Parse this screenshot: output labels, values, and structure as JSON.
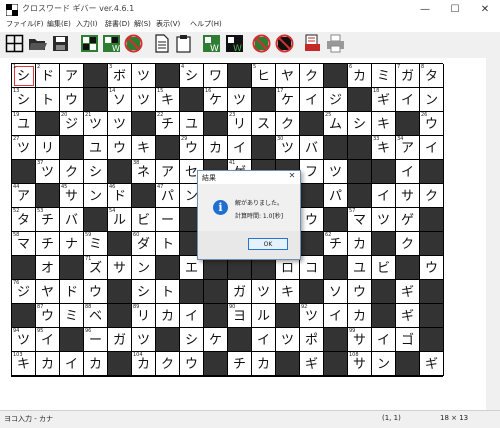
{
  "window": {
    "title": "クロスワード ギバー ver.4.6.1",
    "min_glyph": "—",
    "max_glyph": "☐",
    "close_glyph": "✕"
  },
  "menu": [
    "ファイル(F)",
    "編集(E)",
    "入力(I)",
    "辞書(D)",
    "解(S)",
    "表示(V)",
    "ヘルプ(H)"
  ],
  "toolbar_icons": [
    "new-grid-icon",
    "open-folder-icon",
    "save-icon",
    "pattern-icon",
    "pattern-w-icon",
    "no-pattern-icon",
    "document-icon",
    "clipboard-icon",
    "solve-w-icon",
    "solve-icon",
    "solve-no-icon",
    "solve-no-bold-icon",
    "print-preview-icon",
    "print-icon"
  ],
  "grid": {
    "cols": 18,
    "rows": 13,
    "cells": [
      [
        "1|シ",
        "2|ド",
        "|ア",
        "#",
        "3|ボ",
        "|ツ",
        "#",
        "4|シ",
        "|ワ",
        "#",
        "5|ヒ",
        "|ヤ",
        "|ク",
        "#",
        "6|カ",
        "|ミ",
        "7|ガ",
        "8|タ"
      ],
      [
        "13|シ",
        "|ト",
        "|ウ",
        "#",
        "14|ソ",
        "|ツ",
        "15|キ",
        "#",
        "16|ケ",
        "|ツ",
        "#",
        "17|ケ",
        "|イ",
        "|ジ",
        "#",
        "18|ギ",
        "|イ",
        "|ン"
      ],
      [
        "19|ユ",
        "#",
        "20|ジ",
        "21|ツ",
        "|ツ",
        "#",
        "22|チ",
        "|ユ",
        "#",
        "23|リ",
        "|ス",
        "|ク",
        "#",
        "25|ム",
        "|シ",
        "|キ",
        "#",
        "26|ウ"
      ],
      [
        "27|ツ",
        "|リ",
        "#",
        "|ユ",
        "|ウ",
        "|キ",
        "#",
        "29|ウ",
        "|カ",
        "|イ",
        "#",
        "30|ツ",
        "|バ",
        "#",
        "#",
        "33|キ",
        "34|ア",
        "|イ"
      ],
      [
        "#",
        "37|ツ",
        "|ク",
        "|シ",
        "#",
        "38|ネ",
        "|ア",
        "|セ",
        "#",
        "41|ゲ",
        "#",
        "#",
        "|フ",
        "|ツ",
        "#",
        "#",
        "|イ",
        "#"
      ],
      [
        "44|ア",
        "#",
        "45|サ",
        "|ン",
        "46|ド",
        "#",
        "47|パ",
        "|ン",
        "#",
        "#",
        "#",
        "#",
        "#",
        "|パ",
        "#",
        "|イ",
        "|サ",
        "|ク"
      ],
      [
        "52|タ",
        "53|チ",
        "|バ",
        "#",
        "54|ル",
        "|ビ",
        "|ー",
        "#",
        "#",
        "#",
        "#",
        "#",
        "|ウ",
        "#",
        "57|マ",
        "|ツ",
        "|ゲ",
        "#"
      ],
      [
        "58|マ",
        "|チ",
        "|ナ",
        "59|ミ",
        "#",
        "60|ダ",
        "|ト",
        "#",
        "#",
        "#",
        "#",
        "#",
        "#",
        "62|チ",
        "|カ",
        "#",
        "|ク",
        "#"
      ],
      [
        "#",
        "|オ",
        "#",
        "71|ズ",
        "|サ",
        "|ン",
        "#",
        "|エ",
        "#",
        "#",
        "#",
        "|ロ",
        "|コ",
        "#",
        "|ユ",
        "|ビ",
        "#",
        "|ウ"
      ],
      [
        "76|ジ",
        "|ヤ",
        "|ド",
        "|ウ",
        "#",
        "|シ",
        "|ト",
        "#",
        "#",
        "|ガ",
        "|ツ",
        "|キ",
        "#",
        "|ソ",
        "|ウ",
        "#",
        "|ギ",
        "#"
      ],
      [
        "#",
        "87|ウ",
        "|ミ",
        "88|ベ",
        "#",
        "89|リ",
        "|カ",
        "|イ",
        "#",
        "90|ヨ",
        "|ル",
        "#",
        "92|ツ",
        "|イ",
        "|カ",
        "#",
        "|ギ",
        "#"
      ],
      [
        "94|ツ",
        "95|イ",
        "#",
        "96|ー",
        "|ガ",
        "|ツ",
        "#",
        "|シ",
        "|ケ",
        "#",
        "|イ",
        "|ツ",
        "|ポ",
        "#",
        "99|サ",
        "|イ",
        "|ゴ",
        "#"
      ],
      [
        "103|キ",
        "|カ",
        "|イ",
        "|カ",
        "#",
        "104|カ",
        "|ク",
        "|ウ",
        "#",
        "|チ",
        "|カ",
        "#",
        "|ギ",
        "#",
        "108|サ",
        "|ン",
        "#",
        "|ギ"
      ]
    ]
  },
  "dialog": {
    "title": "結果",
    "close": "✕",
    "info_icon": "i",
    "message": "解がありました。",
    "time_label": "計算時間: 1.0[秒]",
    "ok_label": "OK"
  },
  "status": {
    "mode": "ヨコ入力 - カナ",
    "cursor": "(1, 1)",
    "size": "18 × 13"
  }
}
